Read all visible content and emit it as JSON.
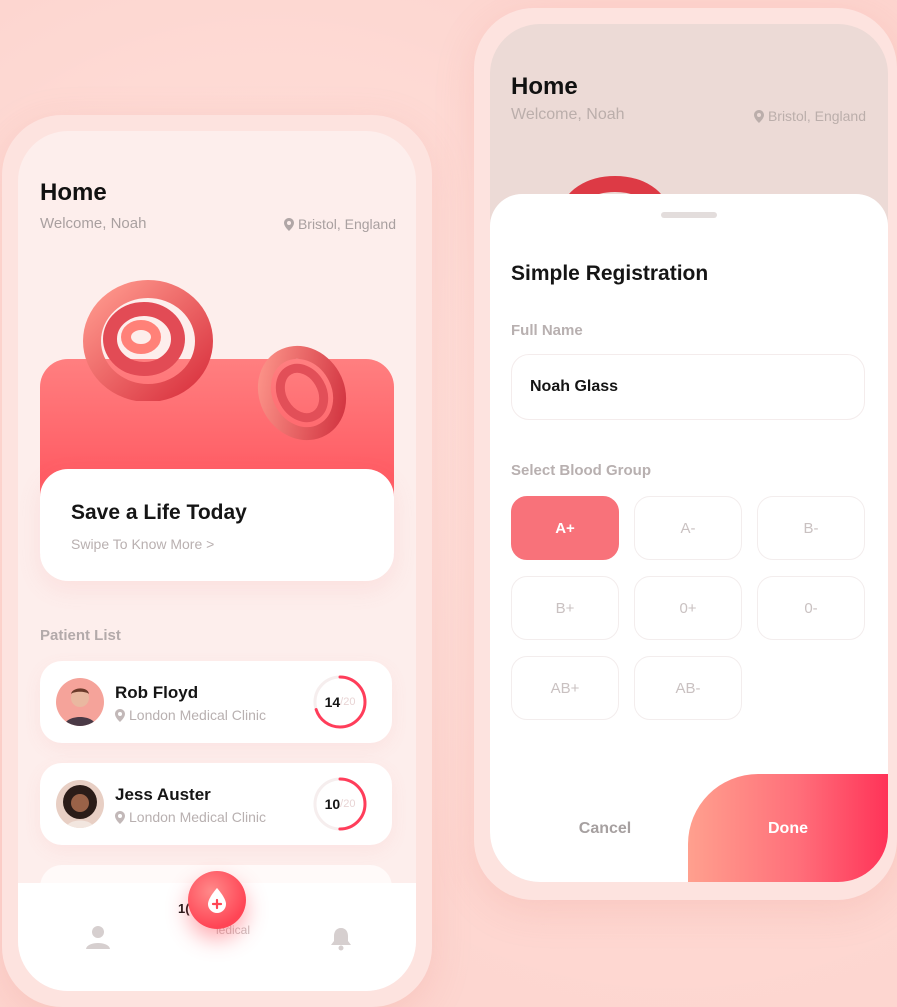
{
  "home_screen": {
    "title": "Home",
    "welcome": "Welcome, Noah",
    "location": "Bristol, England",
    "banner": {
      "title": "Save a Life Today",
      "subtitle": "Swipe To Know More >"
    },
    "patient_list_label": "Patient List",
    "patients": [
      {
        "name": "Rob Floyd",
        "clinic": "London Medical Clinic",
        "count": "14",
        "total": "/20",
        "progress": 0.7
      },
      {
        "name": "Jess Auster",
        "clinic": "London Medical Clinic",
        "count": "10",
        "total": "/20",
        "progress": 0.5
      }
    ],
    "tabbar": {
      "ghost_number": "1(",
      "ghost_label": "ledical"
    },
    "colors": {
      "accent": "#ff4f5e",
      "bg": "#fdd5cf"
    }
  },
  "registration_screen": {
    "title": "Home",
    "welcome": "Welcome, Noah",
    "location": "Bristol, England",
    "sheet": {
      "title": "Simple Registration",
      "full_name_label": "Full Name",
      "full_name_value": "Noah Glass",
      "blood_group_label": "Select Blood Group",
      "blood_groups": [
        "A+",
        "A-",
        "B-",
        "B+",
        "0+",
        "0-",
        "AB+",
        "AB-"
      ],
      "selected_blood_group": "A+",
      "cancel_label": "Cancel",
      "done_label": "Done"
    }
  }
}
